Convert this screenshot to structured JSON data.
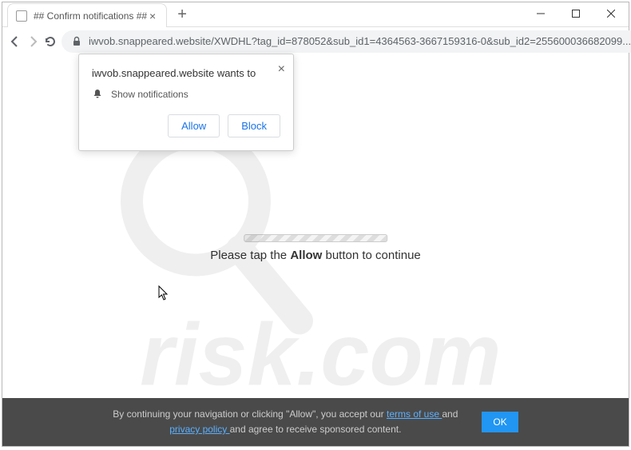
{
  "tab": {
    "title": "## Confirm notifications ##"
  },
  "url": {
    "text": "iwvob.snappeared.website/XWDHL?tag_id=878052&sub_id1=4364563-3667159316-0&sub_id2=255600036682099..."
  },
  "permission": {
    "title": "iwvob.snappeared.website wants to",
    "row_label": "Show notifications",
    "allow": "Allow",
    "block": "Block"
  },
  "page": {
    "msg_pre": "Please tap the ",
    "msg_bold": "Allow",
    "msg_post": " button to continue"
  },
  "footer": {
    "line1_pre": "By continuing your navigation or clicking \"Allow\", you accept our ",
    "terms": "terms of use ",
    "line1_mid": "and",
    "privacy": "privacy policy ",
    "line2_post": "and agree to receive sponsored content.",
    "ok": "OK"
  }
}
